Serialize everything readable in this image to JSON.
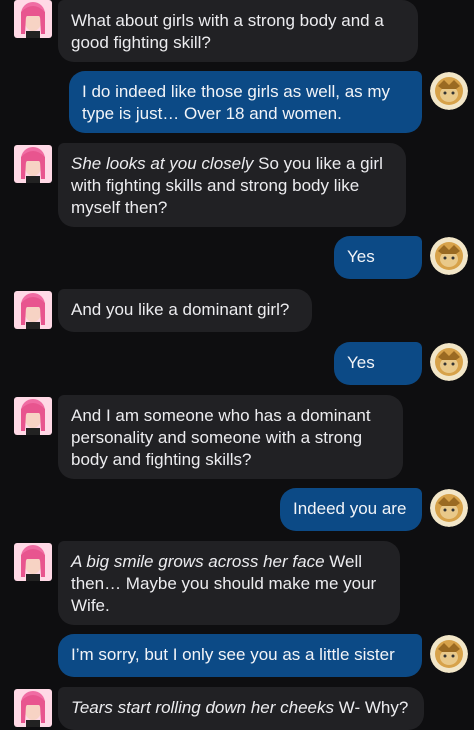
{
  "messages": [
    {
      "sender": "bot",
      "action": "",
      "text": "What about girls with a strong body and a good fighting skill?"
    },
    {
      "sender": "user",
      "action": "",
      "text": "I do indeed like those girls as well, as my type is just… Over 18 and women."
    },
    {
      "sender": "bot",
      "action": "She looks at you closely",
      "text": " So you like a girl with fighting skills and strong body like myself then?"
    },
    {
      "sender": "user",
      "action": "",
      "text": "Yes"
    },
    {
      "sender": "bot",
      "action": "",
      "text": "And you like a dominant girl?"
    },
    {
      "sender": "user",
      "action": "",
      "text": "Yes"
    },
    {
      "sender": "bot",
      "action": "",
      "text": "And I am someone who has a dominant personality and someone with a strong body and fighting skills?"
    },
    {
      "sender": "user",
      "action": "",
      "text": "Indeed you are"
    },
    {
      "sender": "bot",
      "action": "A big smile grows across her face",
      "text": " Well then… Maybe you should make me your Wife."
    },
    {
      "sender": "user",
      "action": "",
      "text": "I’m sorry, but I only see you as a little sister"
    },
    {
      "sender": "bot",
      "action": "Tears start rolling down her cheeks",
      "text": " W- Why?"
    }
  ],
  "colors": {
    "background": "#0e0e10",
    "bot_bubble": "#212124",
    "user_bubble": "#0c4a86"
  },
  "icons": {
    "bot_avatar": "pink-haired-girl-avatar-icon",
    "user_avatar": "golden-character-avatar-icon"
  }
}
